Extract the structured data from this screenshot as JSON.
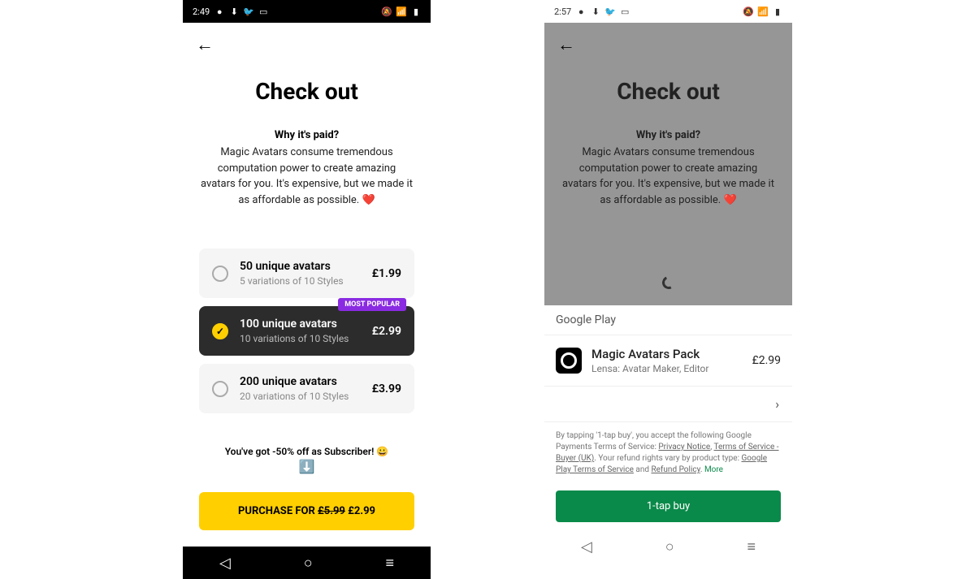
{
  "left": {
    "status": {
      "time": "2:49"
    },
    "title": "Check out",
    "subhead": "Why it's paid?",
    "blurb": "Magic Avatars consume tremendous computation power to create amazing avatars for you. It's expensive, but we made it as affordable as possible.",
    "options": [
      {
        "title": "50 unique avatars",
        "sub": "5 variations of 10 Styles",
        "price": "£1.99"
      },
      {
        "title": "100 unique avatars",
        "sub": "10 variations of 10 Styles",
        "price": "£2.99",
        "badge": "MOST POPULAR"
      },
      {
        "title": "200 unique avatars",
        "sub": "20 variations of 10 Styles",
        "price": "£3.99"
      }
    ],
    "subscriber_note": "You've got -50% off as Subscriber! 😀",
    "purchase_prefix": "PURCHASE FOR ",
    "purchase_old": "£5.99",
    "purchase_new": "£2.99"
  },
  "right": {
    "status": {
      "time": "2:57"
    },
    "title": "Check out",
    "subhead": "Why it's paid?",
    "blurb": "Magic Avatars consume tremendous computation power to create amazing avatars for you. It's expensive, but we made it as affordable as possible.",
    "gplay": {
      "store_label": "Google Play",
      "product_title": "Magic Avatars Pack",
      "product_sub": "Lensa: Avatar Maker, Editor",
      "product_price": "£2.99",
      "legal_pre": "By tapping '1-tap buy', you accept the following Google Payments Terms of Service: ",
      "link_privacy": "Privacy Notice",
      "link_tos": "Terms of Service - Buyer (UK)",
      "legal_mid": ". Your refund rights vary by product type: ",
      "link_gptos": "Google Play Terms of Service",
      "and": " and ",
      "link_refund": "Refund Policy",
      "more": "More",
      "buy_button": "1-tap buy"
    }
  }
}
